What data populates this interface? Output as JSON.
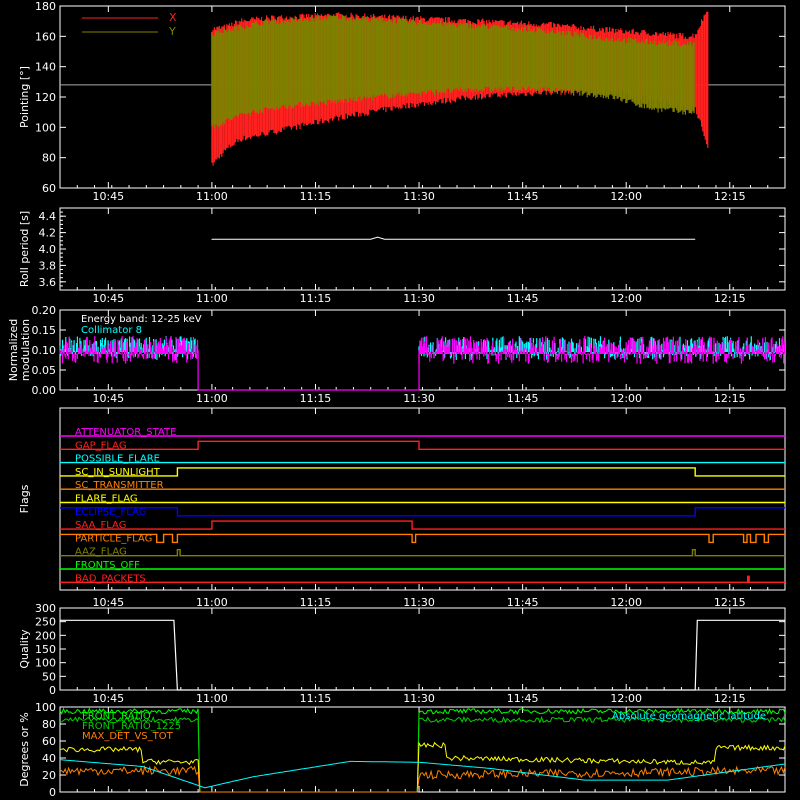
{
  "chart_data": [
    {
      "type": "line",
      "panel": "pointing",
      "ylabel": "Pointing [°]",
      "ylim": [
        60,
        180
      ],
      "yticks": [
        "60",
        "80",
        "100",
        "120",
        "140",
        "160",
        "180"
      ],
      "xticks": [
        "10:45",
        "11:00",
        "11:15",
        "11:30",
        "11:45",
        "12:00",
        "12:15"
      ],
      "xlim_min": [
        0,
        105
      ],
      "legend": [
        "X",
        "Y"
      ],
      "series": [
        {
          "name": "X",
          "color": "#ff2020",
          "x_min": [
            22,
            24,
            26,
            30,
            35,
            40,
            50,
            60,
            70,
            80,
            86,
            91,
            92,
            94
          ],
          "upper": [
            165,
            166,
            170,
            172,
            173,
            174,
            172,
            170,
            168,
            164,
            162,
            160,
            161,
            180
          ],
          "lower": [
            75,
            85,
            92,
            96,
            101,
            106,
            114,
            120,
            123,
            124,
            118,
            112,
            113,
            85
          ]
        },
        {
          "name": "Y",
          "color": "#808000",
          "x_min": [
            22,
            26,
            30,
            35,
            40,
            50,
            60,
            70,
            80,
            86,
            91,
            92
          ],
          "upper": [
            162,
            166,
            170,
            171,
            173,
            170,
            167,
            164,
            158,
            156,
            155,
            155
          ],
          "lower": [
            100,
            108,
            112,
            115,
            117,
            122,
            125,
            125,
            120,
            112,
            110,
            110
          ]
        }
      ],
      "reference_line": 128
    },
    {
      "type": "line",
      "panel": "roll",
      "ylabel": "Roll period [s]",
      "ylim": [
        3.5,
        4.5
      ],
      "yticks": [
        "3.6",
        "3.8",
        "4.0",
        "4.2",
        "4.4"
      ],
      "xticks": [
        "10:45",
        "11:00",
        "11:15",
        "11:30",
        "11:45",
        "12:00",
        "12:15"
      ],
      "series": [
        {
          "name": "roll",
          "color": "#ffffff",
          "x": [
            22,
            92
          ],
          "y": [
            4.12,
            4.12
          ]
        }
      ]
    },
    {
      "type": "line",
      "panel": "modulation",
      "ylabel": "Normalized modulation",
      "ylim": [
        0,
        0.2
      ],
      "yticks": [
        "0.00",
        "0.05",
        "0.10",
        "0.15",
        "0.20"
      ],
      "xticks": [
        "10:45",
        "11:00",
        "11:15",
        "11:30",
        "11:45",
        "12:00",
        "12:15"
      ],
      "annotations": [
        "Energy band: 12-25 keV",
        "Collimator 8"
      ],
      "series": [
        {
          "name": "Collimator 8",
          "color": "#00ffff",
          "segments": [
            [
              0,
              20
            ],
            [
              52,
              105
            ]
          ],
          "mean": 0.105,
          "spread": 0.03
        },
        {
          "name": "magenta",
          "color": "#ff00ff",
          "segments": [
            [
              0,
              20
            ],
            [
              52,
              105
            ]
          ],
          "mean": 0.1,
          "spread": 0.035,
          "zero_segment": [
            20,
            52
          ]
        }
      ]
    },
    {
      "type": "line",
      "panel": "flags",
      "ylabel": "Flags",
      "xticks": [
        "10:45",
        "11:00",
        "11:15",
        "11:30",
        "11:45",
        "12:00",
        "12:15"
      ],
      "flags": [
        {
          "name": "ATTENUATOR_STATE",
          "color": "#ff00ff",
          "steps": [
            [
              0,
              0
            ],
            [
              105,
              0
            ]
          ]
        },
        {
          "name": "GAP_FLAG",
          "color": "#ff2020",
          "steps": [
            [
              0,
              0
            ],
            [
              20,
              1
            ],
            [
              52,
              0
            ],
            [
              105,
              0
            ]
          ]
        },
        {
          "name": "POSSIBLE_FLARE",
          "color": "#00ffff",
          "steps": [
            [
              0,
              0
            ],
            [
              105,
              0
            ]
          ]
        },
        {
          "name": "SC_IN_SUNLIGHT",
          "color": "#ffff00",
          "steps": [
            [
              0,
              0
            ],
            [
              17,
              1
            ],
            [
              92,
              0
            ],
            [
              105,
              0
            ]
          ]
        },
        {
          "name": "SC_TRANSMITTER",
          "color": "#ff8000",
          "steps": [
            [
              0,
              0
            ],
            [
              105,
              0
            ]
          ]
        },
        {
          "name": "FLARE_FLAG",
          "color": "#ffff00",
          "steps": [
            [
              0,
              0
            ],
            [
              105,
              0
            ]
          ]
        },
        {
          "name": "ECLIPSE_FLAG",
          "color": "#0000ff",
          "steps": [
            [
              0,
              1
            ],
            [
              17,
              0
            ],
            [
              92,
              1
            ],
            [
              105,
              1
            ]
          ]
        },
        {
          "name": "SAA_FLAG",
          "color": "#ff2020",
          "steps": [
            [
              0,
              0
            ],
            [
              22,
              1
            ],
            [
              51,
              0
            ],
            [
              105,
              0
            ]
          ]
        },
        {
          "name": "PARTICLE_FLAG",
          "color": "#ff8000",
          "steps": [
            [
              0,
              1
            ],
            [
              105,
              1
            ]
          ]
        },
        {
          "name": "AAZ_FLAG",
          "color": "#808000",
          "steps": [
            [
              0,
              0
            ],
            [
              105,
              0
            ]
          ]
        },
        {
          "name": "FRONTS_OFF",
          "color": "#00ff00",
          "steps": [
            [
              0,
              0
            ],
            [
              105,
              0
            ]
          ]
        },
        {
          "name": "BAD_PACKETS",
          "color": "#ff2020",
          "steps": [
            [
              0,
              0
            ],
            [
              105,
              0
            ]
          ]
        }
      ]
    },
    {
      "type": "line",
      "panel": "quality",
      "ylabel": "Quality",
      "ylim": [
        0,
        300
      ],
      "yticks": [
        "0",
        "50",
        "100",
        "150",
        "200",
        "250",
        "300"
      ],
      "xticks": [
        "10:45",
        "11:00",
        "11:15",
        "11:30",
        "11:45",
        "12:00",
        "12:15"
      ],
      "series": [
        {
          "name": "quality",
          "color": "#ffffff",
          "x": [
            0,
            16.5,
            17,
            92,
            92.3,
            105
          ],
          "y": [
            255,
            255,
            0,
            0,
            255,
            255
          ]
        }
      ]
    },
    {
      "type": "line",
      "panel": "ratios",
      "ylabel": "Degrees or %",
      "ylim": [
        0,
        100
      ],
      "yticks": [
        "0",
        "20",
        "40",
        "60",
        "80",
        "100"
      ],
      "xticks": [
        "10:45",
        "11:00",
        "11:15",
        "11:30",
        "11:45",
        "12:00",
        "12:15"
      ],
      "legend": [
        "FRONT_RATIO",
        "FRONT_RATIO_1225",
        "MAX_DET_VS_TOT",
        "Absolute geomagnetic latitude"
      ],
      "series": [
        {
          "name": "FRONT_RATIO",
          "color": "#00ff00",
          "x": [
            0,
            20,
            52,
            105
          ],
          "y": [
            95,
            95,
            95,
            95
          ]
        },
        {
          "name": "FRONT_RATIO_1225",
          "color": "#00d000",
          "x": [
            0,
            20,
            52,
            105
          ],
          "y": [
            85,
            85,
            85,
            85
          ]
        },
        {
          "name": "MAX_DET_VS_TOT",
          "color": "#ffff00",
          "x": [
            0,
            20,
            52,
            105
          ],
          "y": [
            50,
            35,
            40,
            50
          ]
        },
        {
          "name": "orange",
          "color": "#ff8000",
          "x": [
            0,
            20,
            52,
            105
          ],
          "y": [
            25,
            25,
            20,
            25
          ]
        },
        {
          "name": "Absolute geomagnetic latitude",
          "color": "#00ffff",
          "x": [
            0,
            12,
            21,
            28,
            42,
            52,
            62,
            76,
            88,
            105
          ],
          "y": [
            38,
            30,
            5,
            18,
            36,
            35,
            28,
            14,
            14,
            33
          ]
        }
      ]
    }
  ]
}
